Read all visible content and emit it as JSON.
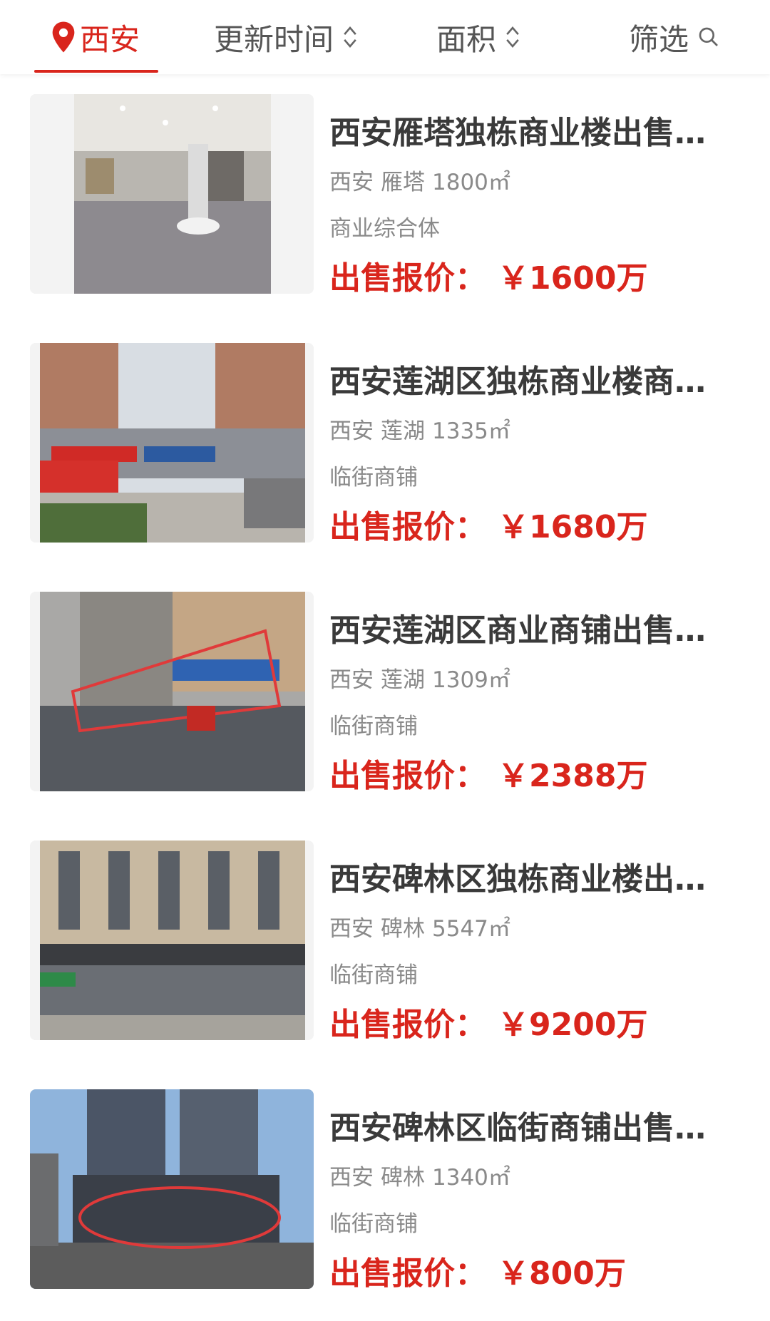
{
  "filter_bar": {
    "location": "西安",
    "sort_update_time": "更新时间",
    "sort_area": "面积",
    "filter": "筛选"
  },
  "colors": {
    "accent": "#d9251c",
    "title_text": "#3a3a3a",
    "meta_text": "#8a8a8a"
  },
  "listings": [
    {
      "title": "西安雁塔独栋商业楼出售…",
      "city": "西安",
      "district": "雁塔",
      "area": "1800㎡",
      "type": "商业综合体",
      "price_label": "出售报价：",
      "price": "￥1600万"
    },
    {
      "title": "西安莲湖区独栋商业楼商…",
      "city": "西安",
      "district": "莲湖",
      "area": "1335㎡",
      "type": "临街商铺",
      "price_label": "出售报价：",
      "price": "￥1680万"
    },
    {
      "title": "西安莲湖区商业商铺出售…",
      "city": "西安",
      "district": "莲湖",
      "area": "1309㎡",
      "type": "临街商铺",
      "price_label": "出售报价：",
      "price": "￥2388万"
    },
    {
      "title": "西安碑林区独栋商业楼出…",
      "city": "西安",
      "district": "碑林",
      "area": "5547㎡",
      "type": "临街商铺",
      "price_label": "出售报价：",
      "price": "￥9200万"
    },
    {
      "title": "西安碑林区临街商铺出售…",
      "city": "西安",
      "district": "碑林",
      "area": "1340㎡",
      "type": "临街商铺",
      "price_label": "出售报价：",
      "price": "￥800万"
    }
  ]
}
